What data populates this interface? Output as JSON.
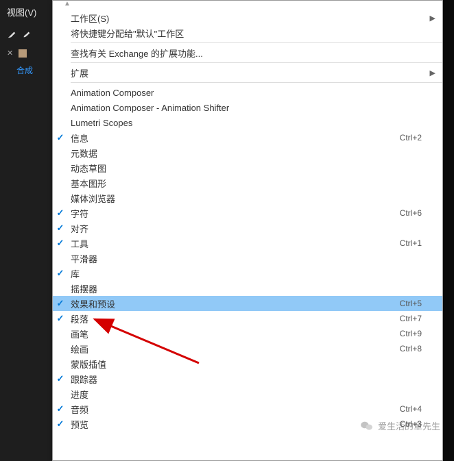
{
  "sidebar": {
    "menu_title": "视图(V)",
    "tab_label": "合成"
  },
  "menu": {
    "items": [
      {
        "label": "工作区(S)",
        "checked": false,
        "shortcut": "",
        "submenu": true
      },
      {
        "label": "将快捷键分配给\"默认\"工作区",
        "checked": false,
        "shortcut": "",
        "submenu": false
      },
      {
        "sep": true
      },
      {
        "label": "查找有关 Exchange 的扩展功能...",
        "checked": false,
        "shortcut": "",
        "submenu": false
      },
      {
        "sep": true
      },
      {
        "label": "扩展",
        "checked": false,
        "shortcut": "",
        "submenu": true
      },
      {
        "sep": true
      },
      {
        "label": "Animation Composer",
        "checked": false,
        "shortcut": "",
        "submenu": false
      },
      {
        "label": "Animation Composer - Animation Shifter",
        "checked": false,
        "shortcut": "",
        "submenu": false
      },
      {
        "label": "Lumetri Scopes",
        "checked": false,
        "shortcut": "",
        "submenu": false
      },
      {
        "label": "信息",
        "checked": true,
        "shortcut": "Ctrl+2",
        "submenu": false
      },
      {
        "label": "元数据",
        "checked": false,
        "shortcut": "",
        "submenu": false
      },
      {
        "label": "动态草图",
        "checked": false,
        "shortcut": "",
        "submenu": false
      },
      {
        "label": "基本图形",
        "checked": false,
        "shortcut": "",
        "submenu": false
      },
      {
        "label": "媒体浏览器",
        "checked": false,
        "shortcut": "",
        "submenu": false
      },
      {
        "label": "字符",
        "checked": true,
        "shortcut": "Ctrl+6",
        "submenu": false
      },
      {
        "label": "对齐",
        "checked": true,
        "shortcut": "",
        "submenu": false
      },
      {
        "label": "工具",
        "checked": true,
        "shortcut": "Ctrl+1",
        "submenu": false
      },
      {
        "label": "平滑器",
        "checked": false,
        "shortcut": "",
        "submenu": false
      },
      {
        "label": "库",
        "checked": true,
        "shortcut": "",
        "submenu": false
      },
      {
        "label": "摇摆器",
        "checked": false,
        "shortcut": "",
        "submenu": false
      },
      {
        "label": "效果和预设",
        "checked": true,
        "shortcut": "Ctrl+5",
        "submenu": false,
        "highlighted": true
      },
      {
        "label": "段落",
        "checked": true,
        "shortcut": "Ctrl+7",
        "submenu": false
      },
      {
        "label": "画笔",
        "checked": false,
        "shortcut": "Ctrl+9",
        "submenu": false
      },
      {
        "label": "绘画",
        "checked": false,
        "shortcut": "Ctrl+8",
        "submenu": false
      },
      {
        "label": "蒙版插值",
        "checked": false,
        "shortcut": "",
        "submenu": false
      },
      {
        "label": "跟踪器",
        "checked": true,
        "shortcut": "",
        "submenu": false
      },
      {
        "label": "进度",
        "checked": false,
        "shortcut": "",
        "submenu": false
      },
      {
        "label": "音频",
        "checked": true,
        "shortcut": "Ctrl+4",
        "submenu": false
      },
      {
        "label": "预览",
        "checked": true,
        "shortcut": "Ctrl+3",
        "submenu": false
      }
    ]
  },
  "watermark": {
    "text": "爱生活的章先生"
  }
}
